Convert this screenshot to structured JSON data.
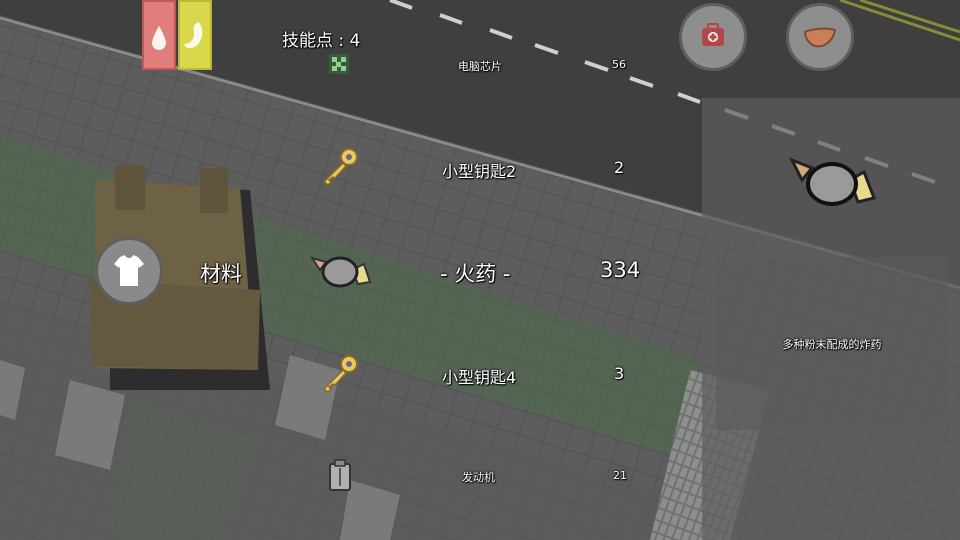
{
  "hud": {
    "skill_points": "技能点 : 4",
    "stat_bars": [
      {
        "name": "thirst",
        "icon": "water-drop-icon",
        "color": "#f08a8a"
      },
      {
        "name": "hunger",
        "icon": "stomach-icon",
        "color": "#e8e85a"
      }
    ],
    "top_buttons": [
      {
        "icon": "medkit-icon"
      },
      {
        "icon": "meat-icon"
      }
    ]
  },
  "inventory": {
    "category_label": "材料",
    "category_icon": "shirt-icon",
    "items": [
      {
        "name": "电脑芯片",
        "count": "56",
        "icon": "chip-icon"
      },
      {
        "name": "小型钥匙2",
        "count": "2",
        "icon": "key-icon"
      },
      {
        "name": "- 火药 -",
        "count": "334",
        "icon": "gunpowder-icon",
        "selected": true
      },
      {
        "name": "小型钥匙4",
        "count": "3",
        "icon": "key-icon"
      },
      {
        "name": "发动机",
        "count": "21",
        "icon": "engine-icon"
      }
    ]
  },
  "detail": {
    "icon": "gunpowder-icon",
    "description": "多种粉末配成的炸药"
  },
  "colors": {
    "thirst": "#f08a8a",
    "hunger": "#e8e85a",
    "panel": "#6a6a6a"
  }
}
